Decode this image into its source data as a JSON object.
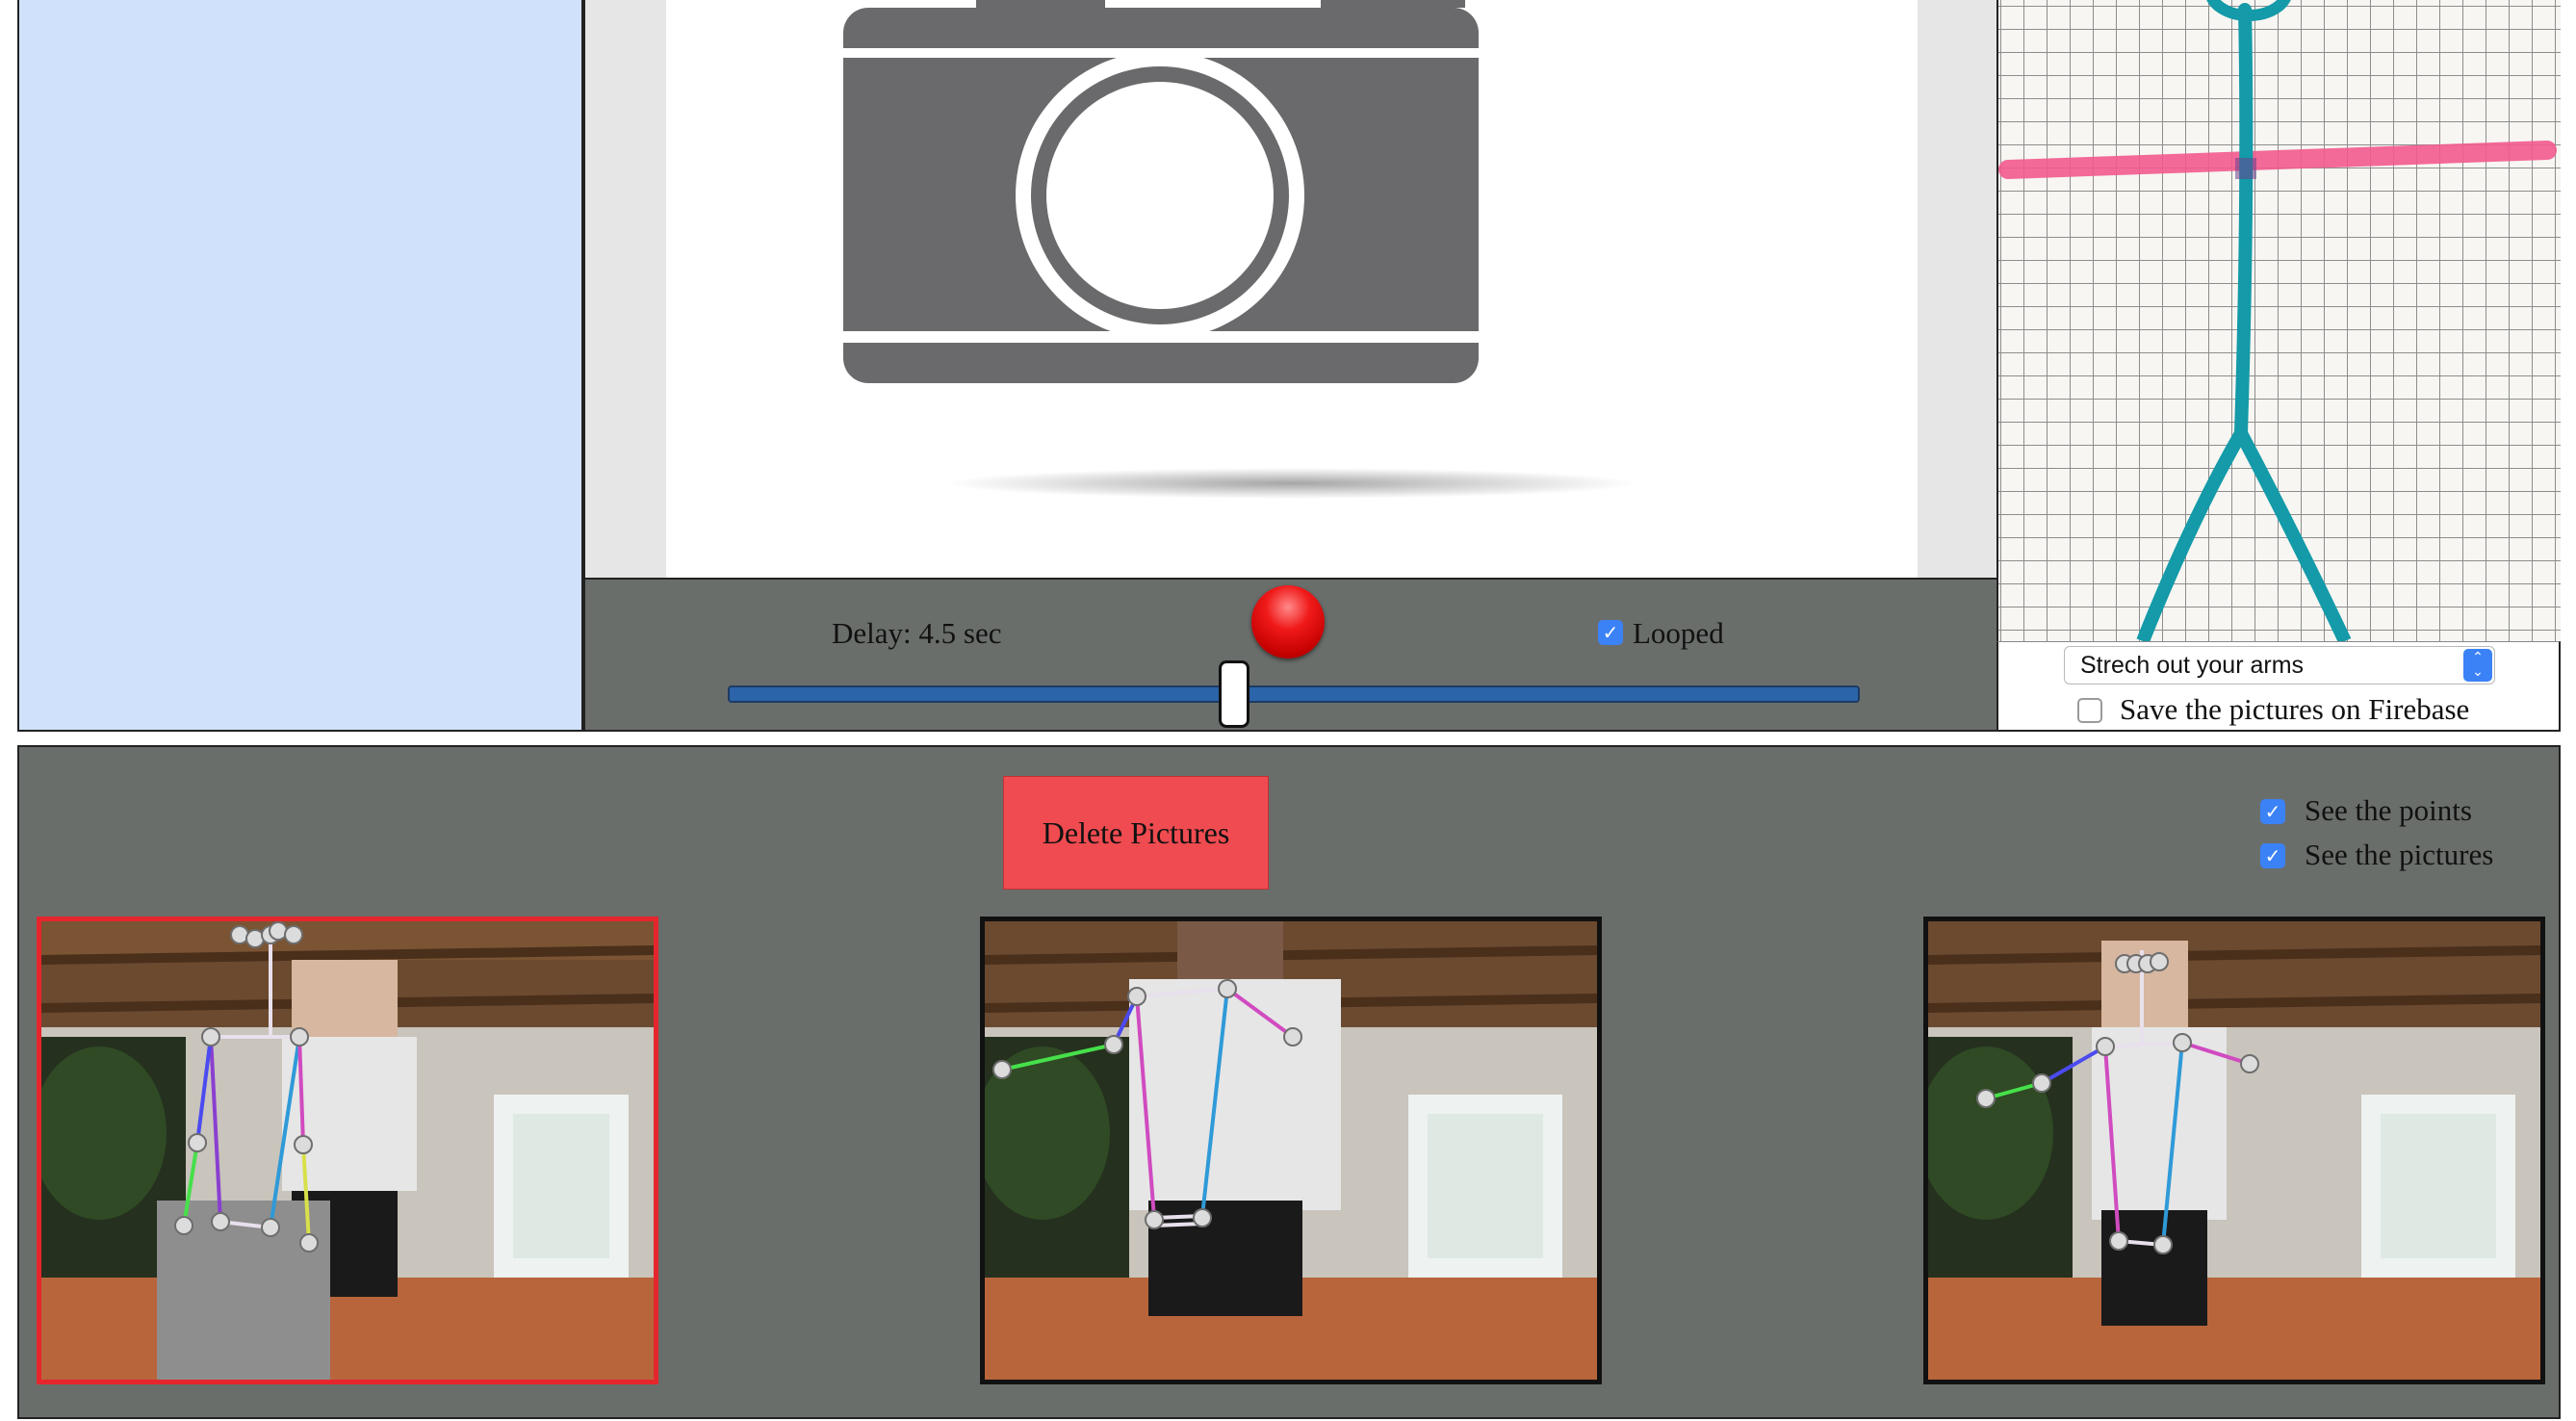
{
  "controls": {
    "delay_label": "Delay: 4.5 sec",
    "delay_seconds": 4.5,
    "looped_label": "Looped",
    "looped_checked": true,
    "record_icon": "record-icon"
  },
  "reference": {
    "select_value": "Strech out your arms",
    "save_firebase_label": "Save the pictures on Firebase",
    "save_firebase_checked": false
  },
  "bottom": {
    "delete_label": "Delete Pictures",
    "see_points_label": "See the points",
    "see_points_checked": true,
    "see_pictures_label": "See the pictures",
    "see_pictures_checked": true
  },
  "colors": {
    "left_panel": "#d0e1fc",
    "panel_gray": "#6a6e6b",
    "delete_button": "#ef4b50",
    "selected_border": "#e5262c",
    "checkbox_blue": "#3b82f6",
    "camera_icon": "#6a696b"
  },
  "icons": {
    "camera": "camera-icon",
    "select_arrows": "chevron-updown-icon",
    "check": "check-icon"
  }
}
